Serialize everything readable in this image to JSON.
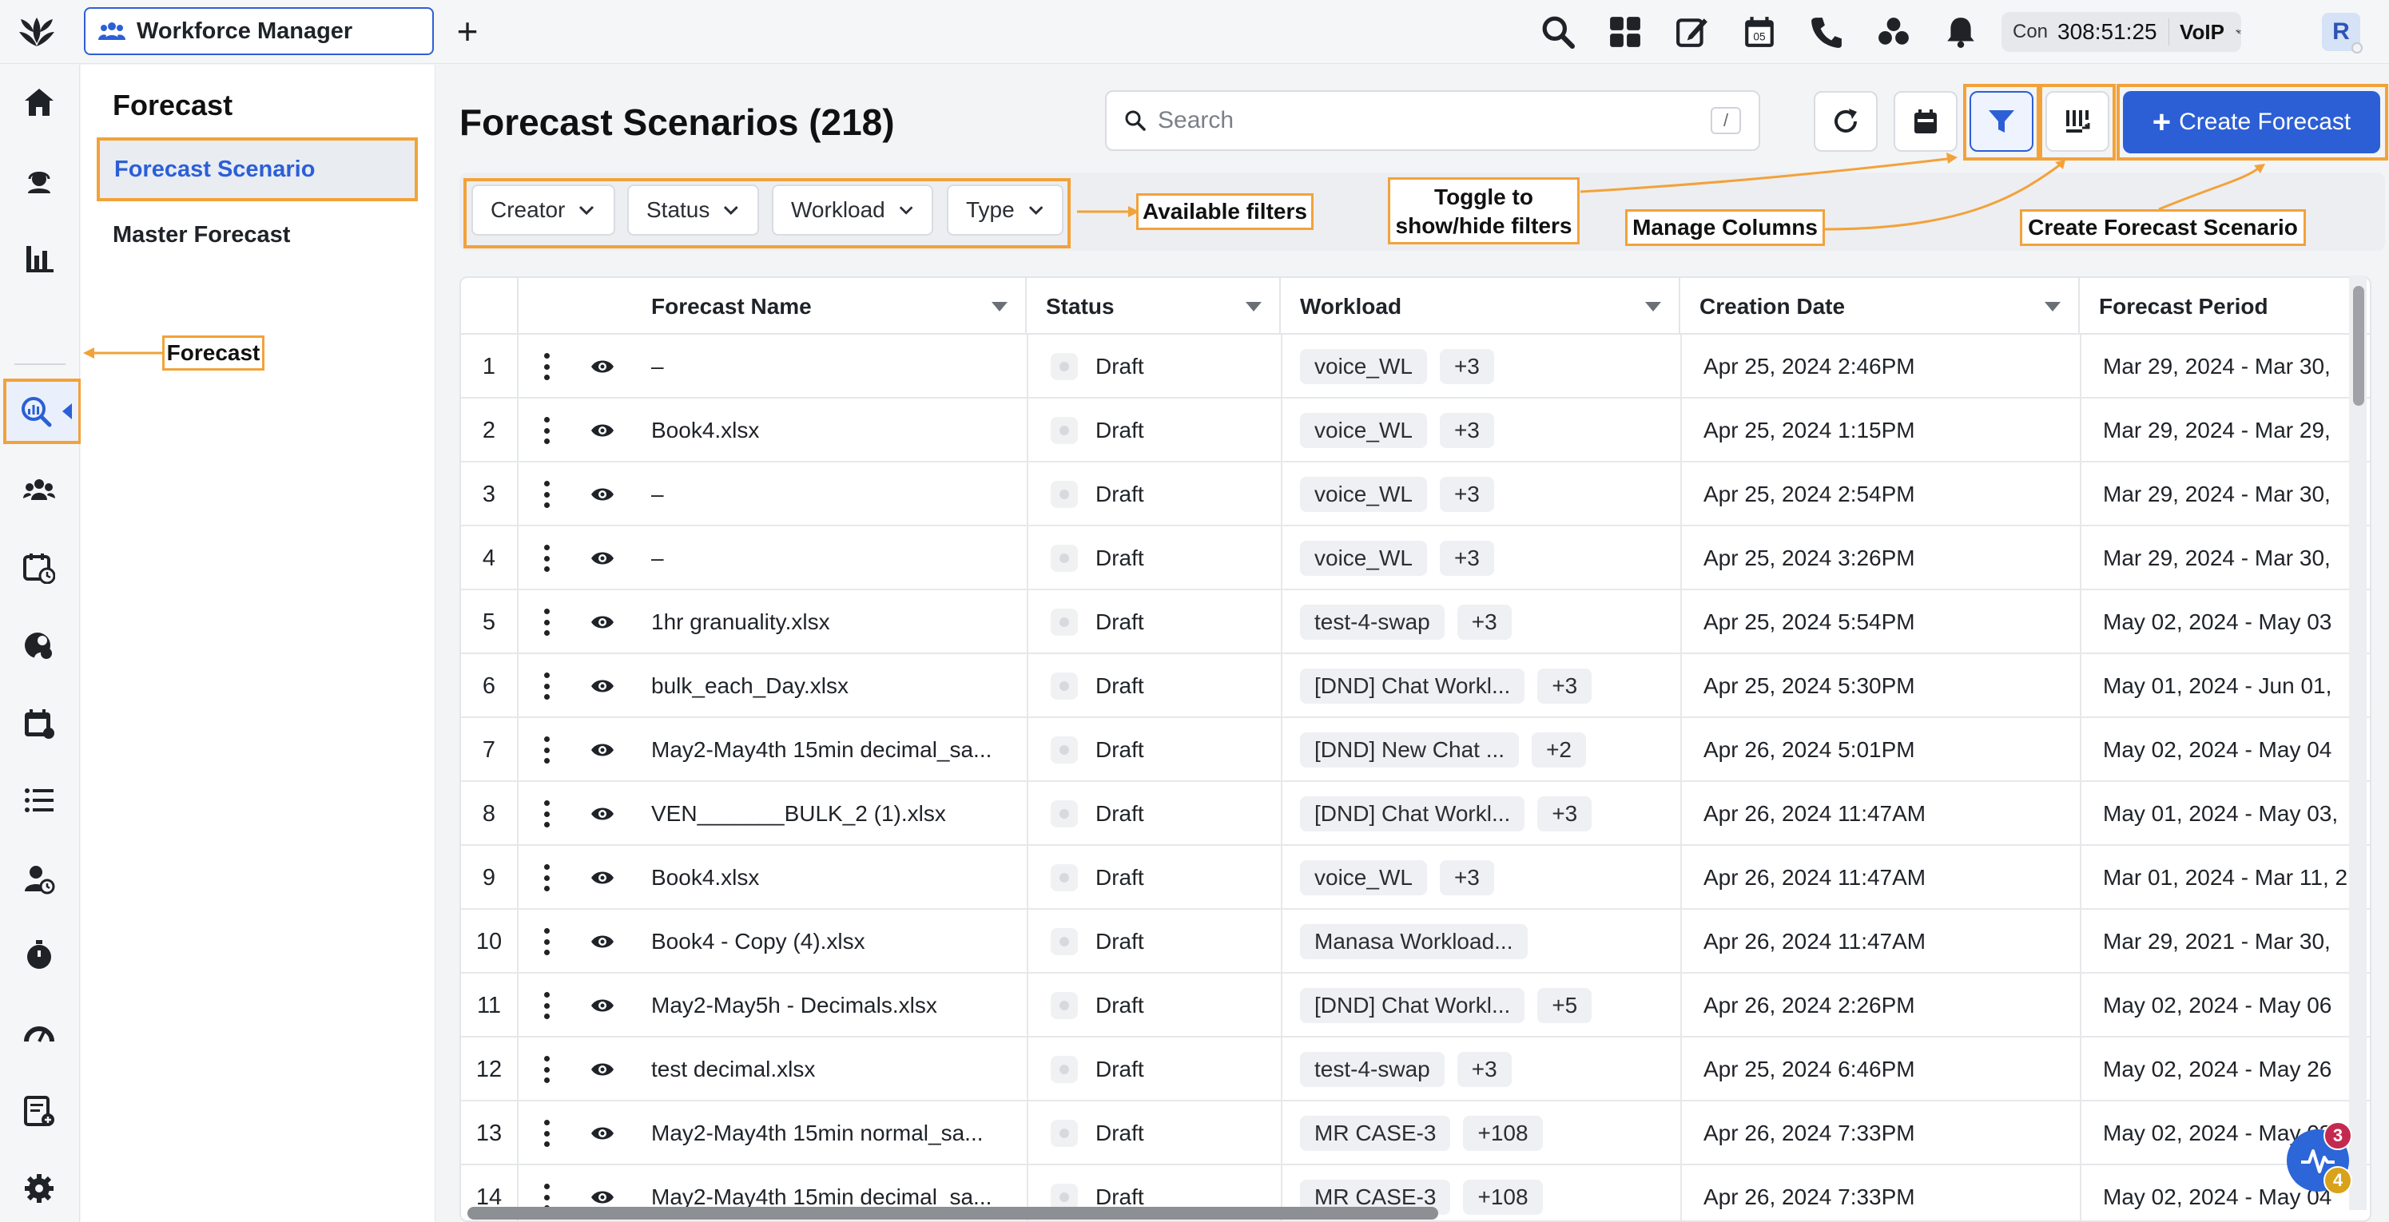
{
  "app": {
    "tab_title": "Workforce Manager",
    "new_tab": "+"
  },
  "topbar": {
    "status_label": "Con",
    "timer": "308:51:25",
    "voip": "VoIP",
    "avatar": "R",
    "calendar_day": "05"
  },
  "submenu": {
    "title": "Forecast",
    "items": [
      {
        "label": "Forecast Scenario",
        "active": true
      },
      {
        "label": "Master Forecast",
        "active": false
      }
    ]
  },
  "main": {
    "title": "Forecast Scenarios (218)",
    "search_placeholder": "Search",
    "search_shortcut": "/",
    "create_label": "Create Forecast",
    "filters": [
      "Creator",
      "Status",
      "Workload",
      "Type"
    ]
  },
  "annotations": {
    "forecast": "Forecast",
    "available_filters": "Available filters",
    "toggle_line1": "Toggle to",
    "toggle_line2": "show/hide filters",
    "manage_columns": "Manage Columns",
    "create_scenario": "Create Forecast Scenario"
  },
  "table": {
    "columns": [
      "Forecast Name",
      "Status",
      "Workload",
      "Creation Date",
      "Forecast Period"
    ],
    "rows": [
      {
        "n": "1",
        "name": "–",
        "status": "Draft",
        "workload": "voice_WL",
        "extra": "+3",
        "date": "Apr 25, 2024 2:46PM",
        "period": "Mar 29, 2024 - Mar 30,"
      },
      {
        "n": "2",
        "name": "Book4.xlsx",
        "status": "Draft",
        "workload": "voice_WL",
        "extra": "+3",
        "date": "Apr 25, 2024 1:15PM",
        "period": "Mar 29, 2024 - Mar 29,"
      },
      {
        "n": "3",
        "name": "–",
        "status": "Draft",
        "workload": "voice_WL",
        "extra": "+3",
        "date": "Apr 25, 2024 2:54PM",
        "period": "Mar 29, 2024 - Mar 30,"
      },
      {
        "n": "4",
        "name": "–",
        "status": "Draft",
        "workload": "voice_WL",
        "extra": "+3",
        "date": "Apr 25, 2024 3:26PM",
        "period": "Mar 29, 2024 - Mar 30,"
      },
      {
        "n": "5",
        "name": "1hr granuality.xlsx",
        "status": "Draft",
        "workload": "test-4-swap",
        "extra": "+3",
        "date": "Apr 25, 2024 5:54PM",
        "period": "May 02, 2024 - May 03"
      },
      {
        "n": "6",
        "name": "bulk_each_Day.xlsx",
        "status": "Draft",
        "workload": "[DND] Chat Workl...",
        "extra": "+3",
        "date": "Apr 25, 2024 5:30PM",
        "period": "May 01, 2024 - Jun 01,"
      },
      {
        "n": "7",
        "name": "May2-May4th 15min decimal_sa...",
        "status": "Draft",
        "workload": "[DND] New Chat ...",
        "extra": "+2",
        "date": "Apr 26, 2024 5:01PM",
        "period": "May 02, 2024 - May 04"
      },
      {
        "n": "8",
        "name": "VEN_______BULK_2 (1).xlsx",
        "status": "Draft",
        "workload": "[DND] Chat Workl...",
        "extra": "+3",
        "date": "Apr 26, 2024 11:47AM",
        "period": "May 01, 2024 - May 03,"
      },
      {
        "n": "9",
        "name": "Book4.xlsx",
        "status": "Draft",
        "workload": "voice_WL",
        "extra": "+3",
        "date": "Apr 26, 2024 11:47AM",
        "period": "Mar 01, 2024 - Mar 11, 2"
      },
      {
        "n": "10",
        "name": "Book4 - Copy (4).xlsx",
        "status": "Draft",
        "workload": "Manasa Workload...",
        "extra": "",
        "date": "Apr 26, 2024 11:47AM",
        "period": "Mar 29, 2021 - Mar 30,"
      },
      {
        "n": "11",
        "name": "May2-May5h - Decimals.xlsx",
        "status": "Draft",
        "workload": "[DND] Chat Workl...",
        "extra": "+5",
        "date": "Apr 26, 2024 2:26PM",
        "period": "May 02, 2024 - May 06"
      },
      {
        "n": "12",
        "name": "test decimal.xlsx",
        "status": "Draft",
        "workload": "test-4-swap",
        "extra": "+3",
        "date": "Apr 25, 2024 6:46PM",
        "period": "May 02, 2024 - May 26"
      },
      {
        "n": "13",
        "name": "May2-May4th 15min normal_sa...",
        "status": "Draft",
        "workload": "MR CASE-3",
        "extra": "+108",
        "date": "Apr 26, 2024 7:33PM",
        "period": "May 02, 2024 - May 03"
      },
      {
        "n": "14",
        "name": "May2-May4th 15min decimal_sa...",
        "status": "Draft",
        "workload": "MR CASE-3",
        "extra": "+108",
        "date": "Apr 26, 2024 7:33PM",
        "period": "May 02, 2024 - May 04"
      }
    ]
  },
  "notifications": {
    "red_count": "3",
    "yellow_count": "4"
  },
  "colors": {
    "accent": "#2c5fd6",
    "annotation": "#f2a23a"
  }
}
